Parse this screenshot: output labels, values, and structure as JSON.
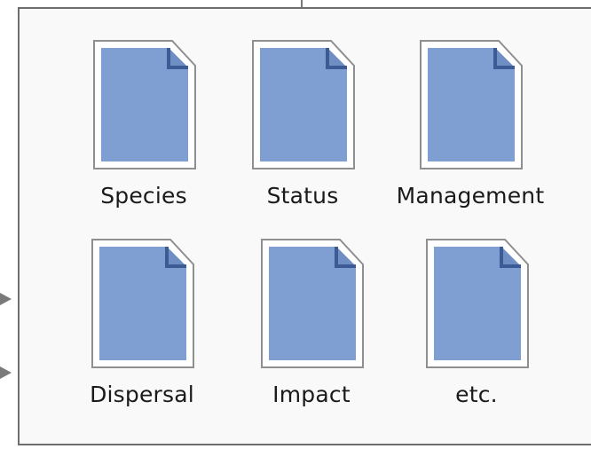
{
  "folder": {
    "items": [
      {
        "label": "Species"
      },
      {
        "label": "Status"
      },
      {
        "label": "Management"
      },
      {
        "label": "Dispersal"
      },
      {
        "label": "Impact"
      },
      {
        "label": "etc."
      }
    ]
  },
  "colors": {
    "page_fill": "#7f9fd2",
    "page_fill_dark": "#6f8fc4",
    "page_outline": "#ffffff",
    "fold_line": "#3c5a94",
    "panel_border": "#6e6e6e"
  },
  "icons": {
    "document": "document-icon"
  }
}
